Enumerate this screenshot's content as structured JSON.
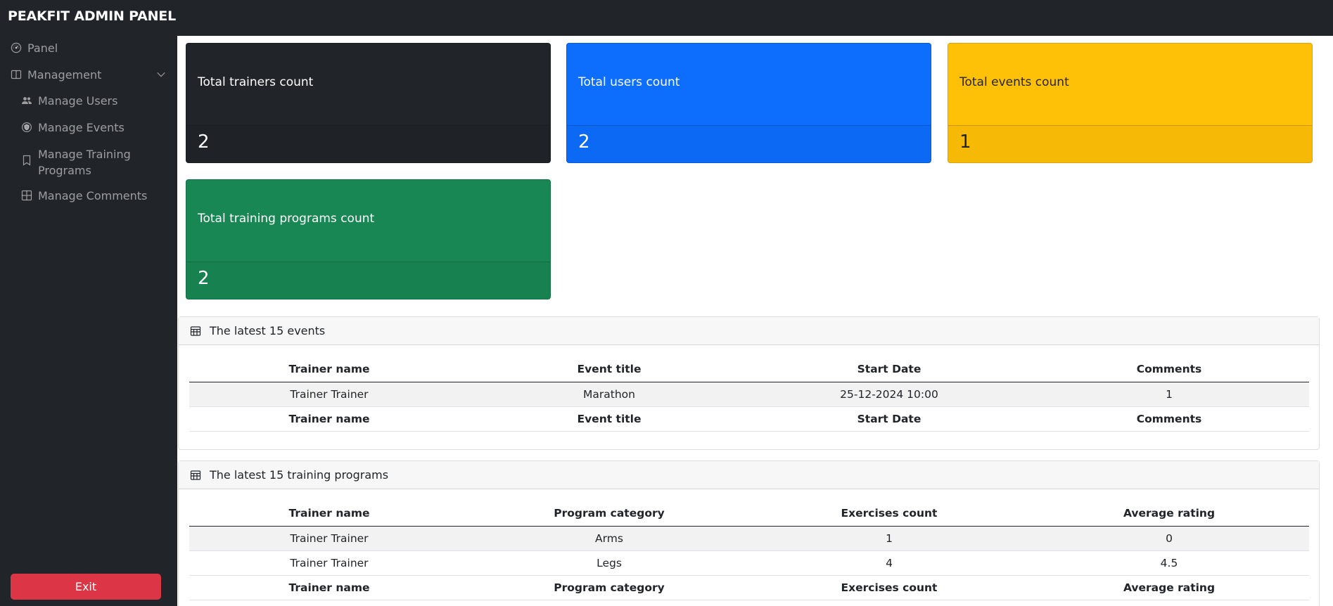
{
  "app": {
    "title": "PEAKFIT ADMIN PANEL"
  },
  "sidebar": {
    "panel_label": "Panel",
    "management_label": "Management",
    "items": [
      {
        "label": "Manage Users",
        "icon": "people-icon"
      },
      {
        "label": "Manage Events",
        "icon": "shield-icon"
      },
      {
        "label": "Manage Training Programs",
        "icon": "bookmark-icon"
      },
      {
        "label": "Manage Comments",
        "icon": "grid-icon"
      }
    ],
    "exit_label": "Exit"
  },
  "stats": [
    {
      "label": "Total trainers count",
      "value": "2",
      "color": "#212529"
    },
    {
      "label": "Total users count",
      "value": "2",
      "color": "#0d6efd"
    },
    {
      "label": "Total events count",
      "value": "1",
      "color": "#ffc107"
    },
    {
      "label": "Total training programs count",
      "value": "2",
      "color": "#198754"
    }
  ],
  "events_table": {
    "title": "The latest 15 events",
    "columns": [
      "Trainer name",
      "Event title",
      "Start Date",
      "Comments"
    ],
    "rows": [
      [
        "Trainer Trainer",
        "Marathon",
        "25-12-2024 10:00",
        "1"
      ]
    ]
  },
  "programs_table": {
    "title": "The latest 15 training programs",
    "columns": [
      "Trainer name",
      "Program category",
      "Exercises count",
      "Average rating"
    ],
    "rows": [
      [
        "Trainer Trainer",
        "Arms",
        "1",
        "0"
      ],
      [
        "Trainer Trainer",
        "Legs",
        "4",
        "4.5"
      ]
    ]
  }
}
